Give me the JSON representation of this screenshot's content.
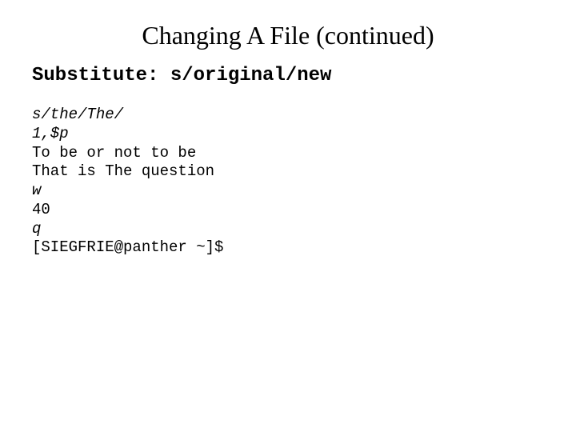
{
  "title": "Changing A File (continued)",
  "subhead": "Substitute:  s/original/new",
  "code": {
    "l1": "s/the/The/",
    "l2": "1,$p",
    "l3": "To be or not to be",
    "l4": "That is The question",
    "l5": "w",
    "l6": "40",
    "l7": "q",
    "l8": "[SIEGFRIE@panther ~]$"
  }
}
